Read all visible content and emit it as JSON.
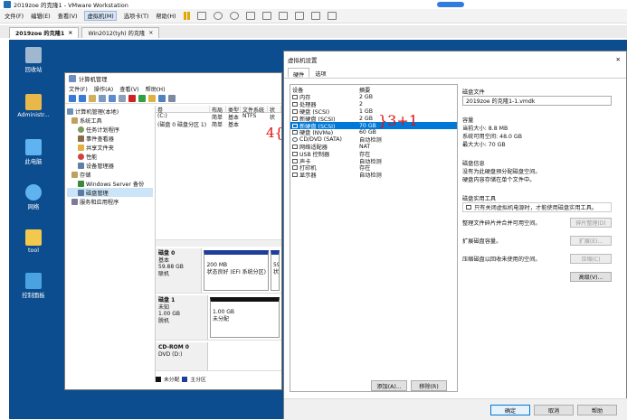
{
  "vmware": {
    "title": "2019zoe 的克隆1 - VMware Workstation",
    "menu": [
      "文件(F)",
      "编辑(E)",
      "查看(V)",
      "虚拟机(M)",
      "选项卡(T)",
      "帮助(H)"
    ],
    "active_menu": "虚拟机(M)",
    "tabs": [
      {
        "label": "2019zoe 的克隆1",
        "active": true
      },
      {
        "label": "Win2012(tyh) 的克隆",
        "active": false
      }
    ],
    "close_glyph": "×"
  },
  "desktop": {
    "icons": [
      {
        "label": "回收站",
        "color": "#9fb7cf"
      },
      {
        "label": "Administr...",
        "color": "#e8b84a"
      },
      {
        "label": "此电脑",
        "color": "#5fb3f0"
      },
      {
        "label": "网络",
        "color": "#5fb3f0"
      },
      {
        "label": "tool",
        "color": "#f2c94c"
      },
      {
        "label": "控制面板",
        "color": "#4aa3e0"
      }
    ]
  },
  "compmgmt": {
    "title": "计算机管理",
    "menu": [
      "文件(F)",
      "操作(A)",
      "查看(V)",
      "帮助(H)"
    ],
    "tree": [
      {
        "label": "计算机管理(本地)",
        "level": 0,
        "color": "#6b8fbf"
      },
      {
        "label": "系统工具",
        "level": 1,
        "color": "#c0a060"
      },
      {
        "label": "任务计划程序",
        "level": 2,
        "color": "#7a9a5a"
      },
      {
        "label": "事件查看器",
        "level": 2,
        "color": "#8a6a4a"
      },
      {
        "label": "共享文件夹",
        "level": 2,
        "color": "#e0b040"
      },
      {
        "label": "性能",
        "level": 2,
        "color": "#d04040"
      },
      {
        "label": "设备管理器",
        "level": 2,
        "color": "#6080a0"
      },
      {
        "label": "存储",
        "level": 1,
        "color": "#c0a060"
      },
      {
        "label": "Windows Server 备份",
        "level": 2,
        "color": "#3a8a3a"
      },
      {
        "label": "磁盘管理",
        "level": 2,
        "color": "#5a7aa0",
        "selected": true
      },
      {
        "label": "服务和应用程序",
        "level": 1,
        "color": "#7a7a9a"
      }
    ],
    "volume_headers": [
      "卷",
      "布局",
      "类型",
      "文件系统",
      "状"
    ],
    "volumes": [
      {
        "name": "(C:)",
        "layout": "简单",
        "type": "基本",
        "fs": "NTFS",
        "status": "状"
      },
      {
        "name": "(磁盘 0 磁盘分区 1)",
        "layout": "简单",
        "type": "基本",
        "fs": "",
        "status": ""
      }
    ],
    "disks": [
      {
        "name": "磁盘 0",
        "type": "基本",
        "size": "59.88 GB",
        "status": "联机",
        "parts": [
          {
            "size": "200 MB",
            "status": "状态良好 (EFI 系统分区)",
            "kind": "sys"
          },
          {
            "size": "59",
            "status": "状",
            "kind": "sys"
          }
        ]
      },
      {
        "name": "磁盘 1",
        "type": "未知",
        "size": "1.00 GB",
        "status": "脱机",
        "parts": [
          {
            "size": "1.00 GB",
            "status": "未分配",
            "kind": "unalloc"
          }
        ]
      },
      {
        "name": "CD-ROM 0",
        "type": "DVD (D:)",
        "size": "",
        "status": "",
        "parts": []
      }
    ],
    "legend": [
      {
        "label": "未分配",
        "color": "#111111"
      },
      {
        "label": "主分区",
        "color": "#1f3d9a"
      }
    ]
  },
  "dialog": {
    "title": "虚拟机设置",
    "close_glyph": "✕",
    "tabs": [
      "硬件",
      "选项"
    ],
    "list_headers": [
      "设备",
      "摘要"
    ],
    "devices": [
      {
        "name": "内存",
        "summary": "2 GB"
      },
      {
        "name": "处理器",
        "summary": "2"
      },
      {
        "name": "硬盘 (SCSI)",
        "summary": "1 GB"
      },
      {
        "name": "新硬盘 (SCSI)",
        "summary": "2 GB"
      },
      {
        "name": "新硬盘 (SCSI)",
        "summary": "70 GB",
        "selected": true
      },
      {
        "name": "硬盘 (NVMe)",
        "summary": "60 GB"
      },
      {
        "name": "CD/DVD (SATA)",
        "summary": "自动检测"
      },
      {
        "name": "网络适配器",
        "summary": "NAT"
      },
      {
        "name": "USB 控制器",
        "summary": "存在"
      },
      {
        "name": "声卡",
        "summary": "自动检测"
      },
      {
        "name": "打印机",
        "summary": "存在"
      },
      {
        "name": "显示器",
        "summary": "自动检测"
      }
    ],
    "add_label": "添加(A)...",
    "remove_label": "移除(R)",
    "disk_file": {
      "heading": "磁盘文件",
      "value": "2019zoe 的克隆1-1.vmdk"
    },
    "capacity": {
      "heading": "容量",
      "current": "当前大小: 8.8 MB",
      "free": "系统可用空间: 48.0 GB",
      "max": "最大大小: 70 GB"
    },
    "info": {
      "heading": "磁盘信息",
      "line1": "没有为此硬盘预分配磁盘空间。",
      "line2": "硬盘内容存储在单个文件中。"
    },
    "utils": {
      "heading": "磁盘实用工具",
      "map_text": "只有关闭虚拟机电源时，才能使用磁盘实用工具。",
      "rows": [
        {
          "text": "整理文件碎片并合并可用空间。",
          "button": "碎片整理(D)"
        },
        {
          "text": "扩展磁盘容量。",
          "button": "扩展(E)..."
        },
        {
          "text": "压缩磁盘以回收未使用的空间。",
          "button": "压缩(C)"
        }
      ],
      "advanced": "高级(V)..."
    },
    "footer": {
      "ok": "确定",
      "cancel": "取消",
      "help": "帮助"
    }
  },
  "annotation": {
    "left": "4{",
    "right": "}3+1"
  }
}
